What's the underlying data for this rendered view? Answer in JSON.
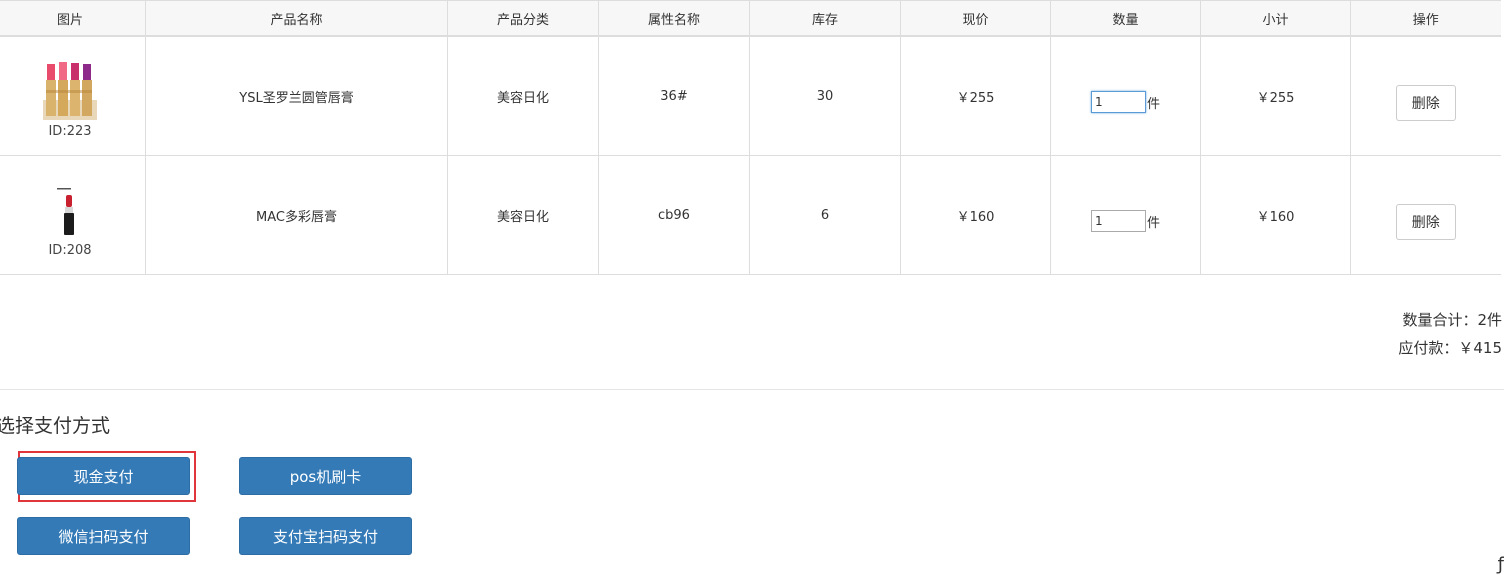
{
  "table": {
    "headers": [
      "图片",
      "产品名称",
      "产品分类",
      "属性名称",
      "库存",
      "现价",
      "数量",
      "小计",
      "操作"
    ],
    "rows": [
      {
        "id_text": "ID:223",
        "name": "YSL圣罗兰圆管唇膏",
        "category": "美容日化",
        "attribute": "36#",
        "stock": "30",
        "price": "￥255",
        "quantity": "1",
        "unit": "件",
        "subtotal": "￥255",
        "delete_label": "删除",
        "image": "ysl-lipsticks-image"
      },
      {
        "id_text": "ID:208",
        "name": "MAC多彩唇膏",
        "category": "美容日化",
        "attribute": "cb96",
        "stock": "6",
        "price": "￥160",
        "quantity": "1",
        "unit": "件",
        "subtotal": "￥160",
        "delete_label": "删除",
        "image": "mac-lipstick-image"
      }
    ]
  },
  "summary": {
    "quantity_total": "数量合计：2件",
    "amount_due": "应付款：￥415"
  },
  "payment": {
    "title": "选择支付方式",
    "cash": "现金支付",
    "pos": "pos机刷卡",
    "wechat": "微信扫码支付",
    "alipay": "支付宝扫码支付"
  },
  "colors": {
    "primary_button": "#337ab7",
    "highlight_border": "#e0353b",
    "table_border": "#dddddd"
  }
}
